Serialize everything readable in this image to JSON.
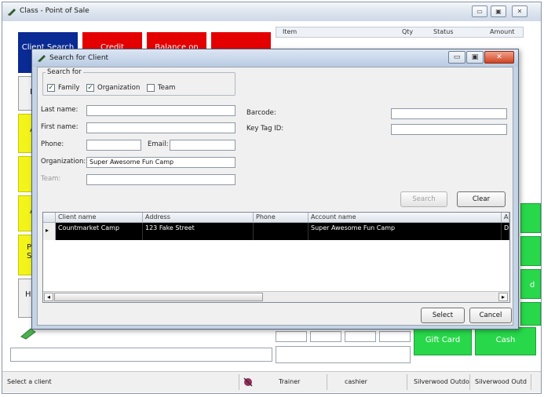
{
  "main_window": {
    "title": "Class - Point of Sale",
    "controls": {
      "minimize": "▭",
      "maximize": "▣",
      "close": "✕"
    },
    "tiles": {
      "client_search": "Client Search",
      "credit": "Credit",
      "balance_on": "Balance on",
      "side_labels": [
        "L",
        "A",
        "P",
        "S",
        "A",
        "Ho"
      ],
      "gift_card": "Gift Card",
      "cash": "Cash",
      "right_edge": "d"
    },
    "line_items_header": {
      "item": "Item",
      "qty": "Qty",
      "status": "Status",
      "amount": "Amount"
    },
    "status_bar": {
      "message": "Select a client",
      "mode": "Trainer",
      "role": "cashier",
      "location1": "Silverwood Outdo",
      "location2": "Silverwood Outd"
    }
  },
  "dialog": {
    "title": "Search for Client",
    "search_for": {
      "legend": "Search for",
      "options": [
        {
          "label": "Family",
          "checked": true
        },
        {
          "label": "Organization",
          "checked": true
        },
        {
          "label": "Team",
          "checked": false
        }
      ]
    },
    "fields": {
      "last_name": {
        "label": "Last name:",
        "value": ""
      },
      "first_name": {
        "label": "First name:",
        "value": ""
      },
      "phone": {
        "label": "Phone:",
        "value": ""
      },
      "email": {
        "label": "Email:",
        "value": ""
      },
      "organization": {
        "label": "Organization:",
        "value": "Super Awesome Fun Camp"
      },
      "team": {
        "label": "Team:",
        "value": ""
      },
      "barcode": {
        "label": "Barcode:",
        "value": ""
      },
      "key_tag_id": {
        "label": "Key Tag ID:",
        "value": ""
      }
    },
    "buttons": {
      "search": "Search",
      "clear": "Clear",
      "select": "Select",
      "cancel": "Cancel"
    },
    "grid": {
      "columns": [
        "Client name",
        "Address",
        "Phone",
        "Account name",
        "A"
      ],
      "rows": [
        [
          "Countmarket Camp",
          "123 Fake Street",
          "",
          "Super Awesome Fun Camp",
          "D"
        ]
      ]
    },
    "scroll_arrows": {
      "left": "◂",
      "right": "▸"
    },
    "row_pointer": "▸"
  }
}
